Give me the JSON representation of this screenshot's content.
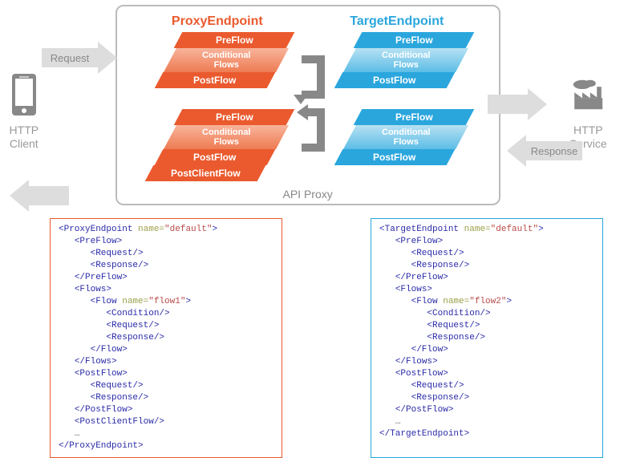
{
  "side": {
    "left_label": "HTTP\nClient",
    "right_label": "HTTP\nService"
  },
  "arrows": {
    "request": "Request",
    "response": "Response"
  },
  "proxy_box": {
    "caption": "API Proxy",
    "cols": {
      "proxy": "ProxyEndpoint",
      "target": "TargetEndpoint"
    },
    "flows": {
      "pre": "PreFlow",
      "cond": "Conditional\nFlows",
      "post": "PostFlow",
      "post_client": "PostClientFlow"
    }
  },
  "code": {
    "proxy": {
      "open": "<ProxyEndpoint name=\"default\">",
      "preflow_open": "<PreFlow>",
      "request": "<Request/>",
      "response": "<Response/>",
      "preflow_close": "</PreFlow>",
      "flows_open": "<Flows>",
      "flow_open": "<Flow name=\"flow1\">",
      "condition": "<Condition/>",
      "flow_close": "</Flow>",
      "flows_close": "</Flows>",
      "postflow_open": "<PostFlow>",
      "postflow_close": "</PostFlow>",
      "postclient": "<PostClientFlow/>",
      "dots": "…",
      "close": "</ProxyEndpoint>"
    },
    "target": {
      "open": "<TargetEndpoint name=\"default\">",
      "preflow_open": "<PreFlow>",
      "request": "<Request/>",
      "response": "<Response/>",
      "preflow_close": "</PreFlow>",
      "flows_open": "<Flows>",
      "flow_open": "<Flow name=\"flow2\">",
      "condition": "<Condition/>",
      "flow_close": "</Flow>",
      "flows_close": "</Flows>",
      "postflow_open": "<PostFlow>",
      "postflow_close": "</PostFlow>",
      "dots": "…",
      "close": "</TargetEndpoint>"
    }
  }
}
